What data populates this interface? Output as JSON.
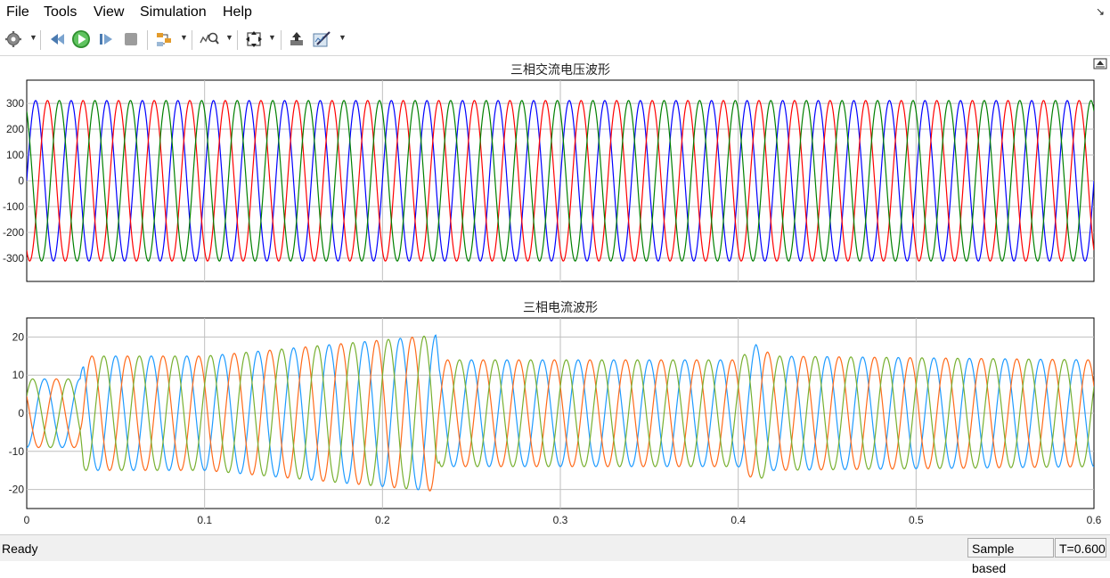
{
  "menu": {
    "file": "File",
    "tools": "Tools",
    "view": "View",
    "simulation": "Simulation",
    "help": "Help"
  },
  "toolbar": {
    "icons": [
      "gear-icon",
      "step-back-icon",
      "run-icon",
      "step-forward-icon",
      "stop-icon",
      "signal-selector-icon",
      "zoom-icon",
      "autoscale-icon",
      "highlight-block-icon",
      "style-icon"
    ]
  },
  "status": {
    "ready": "Ready",
    "mode": "Sample based",
    "time": "T=0.600"
  },
  "chart_data": [
    {
      "type": "line",
      "title": "三相交流电压波形",
      "xlabel": "",
      "ylabel": "",
      "xlim": [
        0,
        0.6
      ],
      "ylim": [
        -390,
        390
      ],
      "yticks": [
        "300",
        "200",
        "100",
        "0",
        "-100",
        "-200",
        "-300"
      ],
      "grid": true,
      "series": [
        {
          "color": "#0000ff",
          "amplitude": 311,
          "frequency_hz": 50,
          "phase_deg": 0
        },
        {
          "color": "#ff0000",
          "amplitude": 311,
          "frequency_hz": 50,
          "phase_deg": -120
        },
        {
          "color": "#008000",
          "amplitude": 311,
          "frequency_hz": 50,
          "phase_deg": 120
        }
      ]
    },
    {
      "type": "line",
      "title": "三相电流波形",
      "xlabel": "",
      "ylabel": "",
      "xlim": [
        0,
        0.6
      ],
      "ylim": [
        -25,
        25
      ],
      "yticks": [
        "20",
        "10",
        "0",
        "-10",
        "-20"
      ],
      "xticks": [
        "0",
        "0.1",
        "0.2",
        "0.3",
        "0.4",
        "0.5",
        "0.6"
      ],
      "grid": true,
      "amplitude_envelope": [
        [
          0,
          9
        ],
        [
          0.03,
          9
        ],
        [
          0.032,
          15
        ],
        [
          0.1,
          15
        ],
        [
          0.23,
          20.5
        ],
        [
          0.232,
          14
        ],
        [
          0.4,
          14
        ],
        [
          0.41,
          18
        ],
        [
          0.42,
          15
        ],
        [
          0.6,
          14
        ]
      ],
      "series": [
        {
          "color": "#1e9bff",
          "frequency_hz": 50,
          "phase_deg": -90
        },
        {
          "color": "#ff6a1a",
          "frequency_hz": 50,
          "phase_deg": 150
        },
        {
          "color": "#77b030",
          "frequency_hz": 50,
          "phase_deg": 30
        }
      ]
    }
  ]
}
